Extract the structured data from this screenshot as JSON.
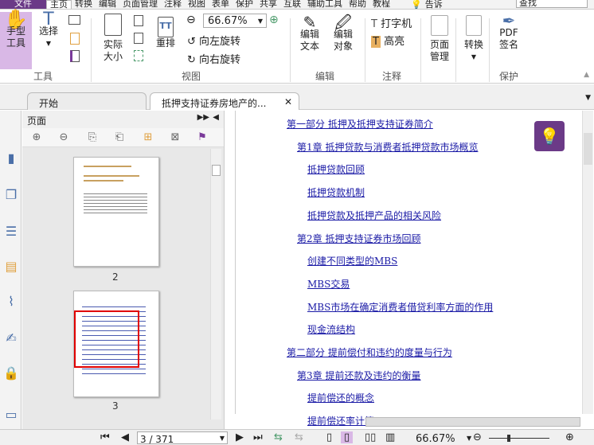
{
  "menu": {
    "file": "文件",
    "items": [
      "主页",
      "转换",
      "编辑",
      "页面管理",
      "注释",
      "视图",
      "表单",
      "保护",
      "共享",
      "互联",
      "辅助工具",
      "帮助",
      "教程"
    ],
    "tell": "告诉",
    "search_placeholder": "查找"
  },
  "ribbon": {
    "hand": "手型\n工具",
    "select": "选择",
    "actual_size": "实际\n大小",
    "reflow": "重排",
    "zoom_value": "66.67%",
    "rotate_left": "向左旋转",
    "rotate_right": "向右旋转",
    "edit_text": "编辑\n文本",
    "edit_object": "编辑\n对象",
    "typewriter": "打字机",
    "highlight": "高亮",
    "page_manage": "页面\n管理",
    "convert": "转换",
    "pdf_sign": "PDF\n签名",
    "groups": {
      "tools": "工具",
      "view": "视图",
      "edit": "编辑",
      "comment": "注释",
      "protect": "保护"
    }
  },
  "tabs": [
    {
      "label": "开始"
    },
    {
      "label": "抵押支持证券房地产的..."
    }
  ],
  "panel": {
    "title": "页面",
    "pages": [
      "2",
      "3"
    ]
  },
  "toc": [
    {
      "text": "第一部分 抵押及抵押支持证券简介",
      "level": 0
    },
    {
      "text": "第1章 抵押贷款与消费者抵押贷款市场概览",
      "level": 1
    },
    {
      "text": "抵押贷款回顾",
      "level": 2
    },
    {
      "text": "抵押贷款机制",
      "level": 2
    },
    {
      "text": "抵押贷款及抵押产品的相关风险",
      "level": 2
    },
    {
      "text": "第2章 抵押支持证券市场回顾",
      "level": 1
    },
    {
      "text": "创建不同类型的MBS",
      "level": 2
    },
    {
      "text": "MBS交易",
      "level": 2
    },
    {
      "text": "MBS市场在确定消费者借贷利率方面的作用",
      "level": 2
    },
    {
      "text": "现金流结构",
      "level": 2
    },
    {
      "text": "第二部分 提前偿付和违约的度量与行为",
      "level": 0
    },
    {
      "text": "第3章 提前还款及违约的衡量",
      "level": 1
    },
    {
      "text": "提前偿还的概念",
      "level": 2
    },
    {
      "text": "提前偿还率计算",
      "level": 2
    }
  ],
  "status": {
    "page": "3 / 371",
    "zoom": "66.67%",
    "zoom_slider": 0.33
  },
  "colors": {
    "accent": "#6b3a87",
    "hand_bg": "#d9b8e6",
    "link": "#1a1aa6",
    "bulb_bg": "#6b3a87"
  }
}
